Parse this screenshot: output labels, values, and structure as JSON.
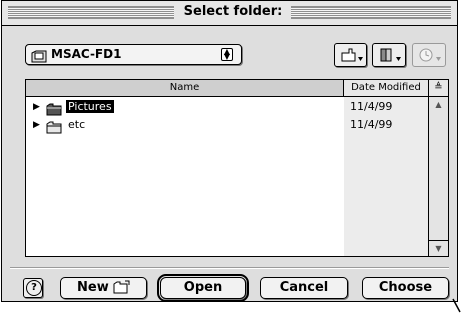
{
  "dialog": {
    "title": "Select folder:"
  },
  "location_popup": {
    "value": "MSAC-FD1"
  },
  "toolbar": {
    "shortcuts_icon": "pointing-hand-icon",
    "favorites_icon": "book-icon",
    "recent_icon": "clock-icon"
  },
  "file_list": {
    "columns": {
      "name": "Name",
      "date": "Date Modified"
    },
    "rows": [
      {
        "name": "Pictures",
        "date": "11/4/99",
        "selected": true
      },
      {
        "name": "etc",
        "date": "11/4/99",
        "selected": false
      }
    ]
  },
  "buttons": {
    "new_label": "New",
    "open_label": "Open",
    "cancel_label": "Cancel",
    "choose_label": "Choose"
  }
}
